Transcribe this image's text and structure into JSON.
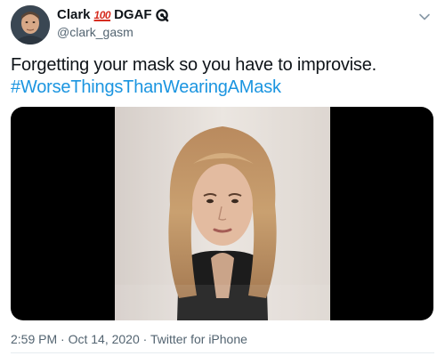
{
  "author": {
    "name": "Clark",
    "emoji": "100",
    "name_suffix": "DGAF",
    "handle": "@clark_gasm"
  },
  "tweet": {
    "text": "Forgetting your mask so you have to improvise.",
    "hashtag": "#WorseThingsThanWearingAMask"
  },
  "meta": {
    "time": "2:59 PM",
    "separator": "·",
    "date": "Oct 14, 2020",
    "source": "Twitter for iPhone"
  },
  "icons": {
    "avatar": "avatar-icon",
    "badge": "quote-badge-icon",
    "menu": "chevron-down-icon"
  },
  "colors": {
    "hashtag": "#1b95e0",
    "secondary_text": "#536471",
    "emoji_red": "#d62d20"
  }
}
